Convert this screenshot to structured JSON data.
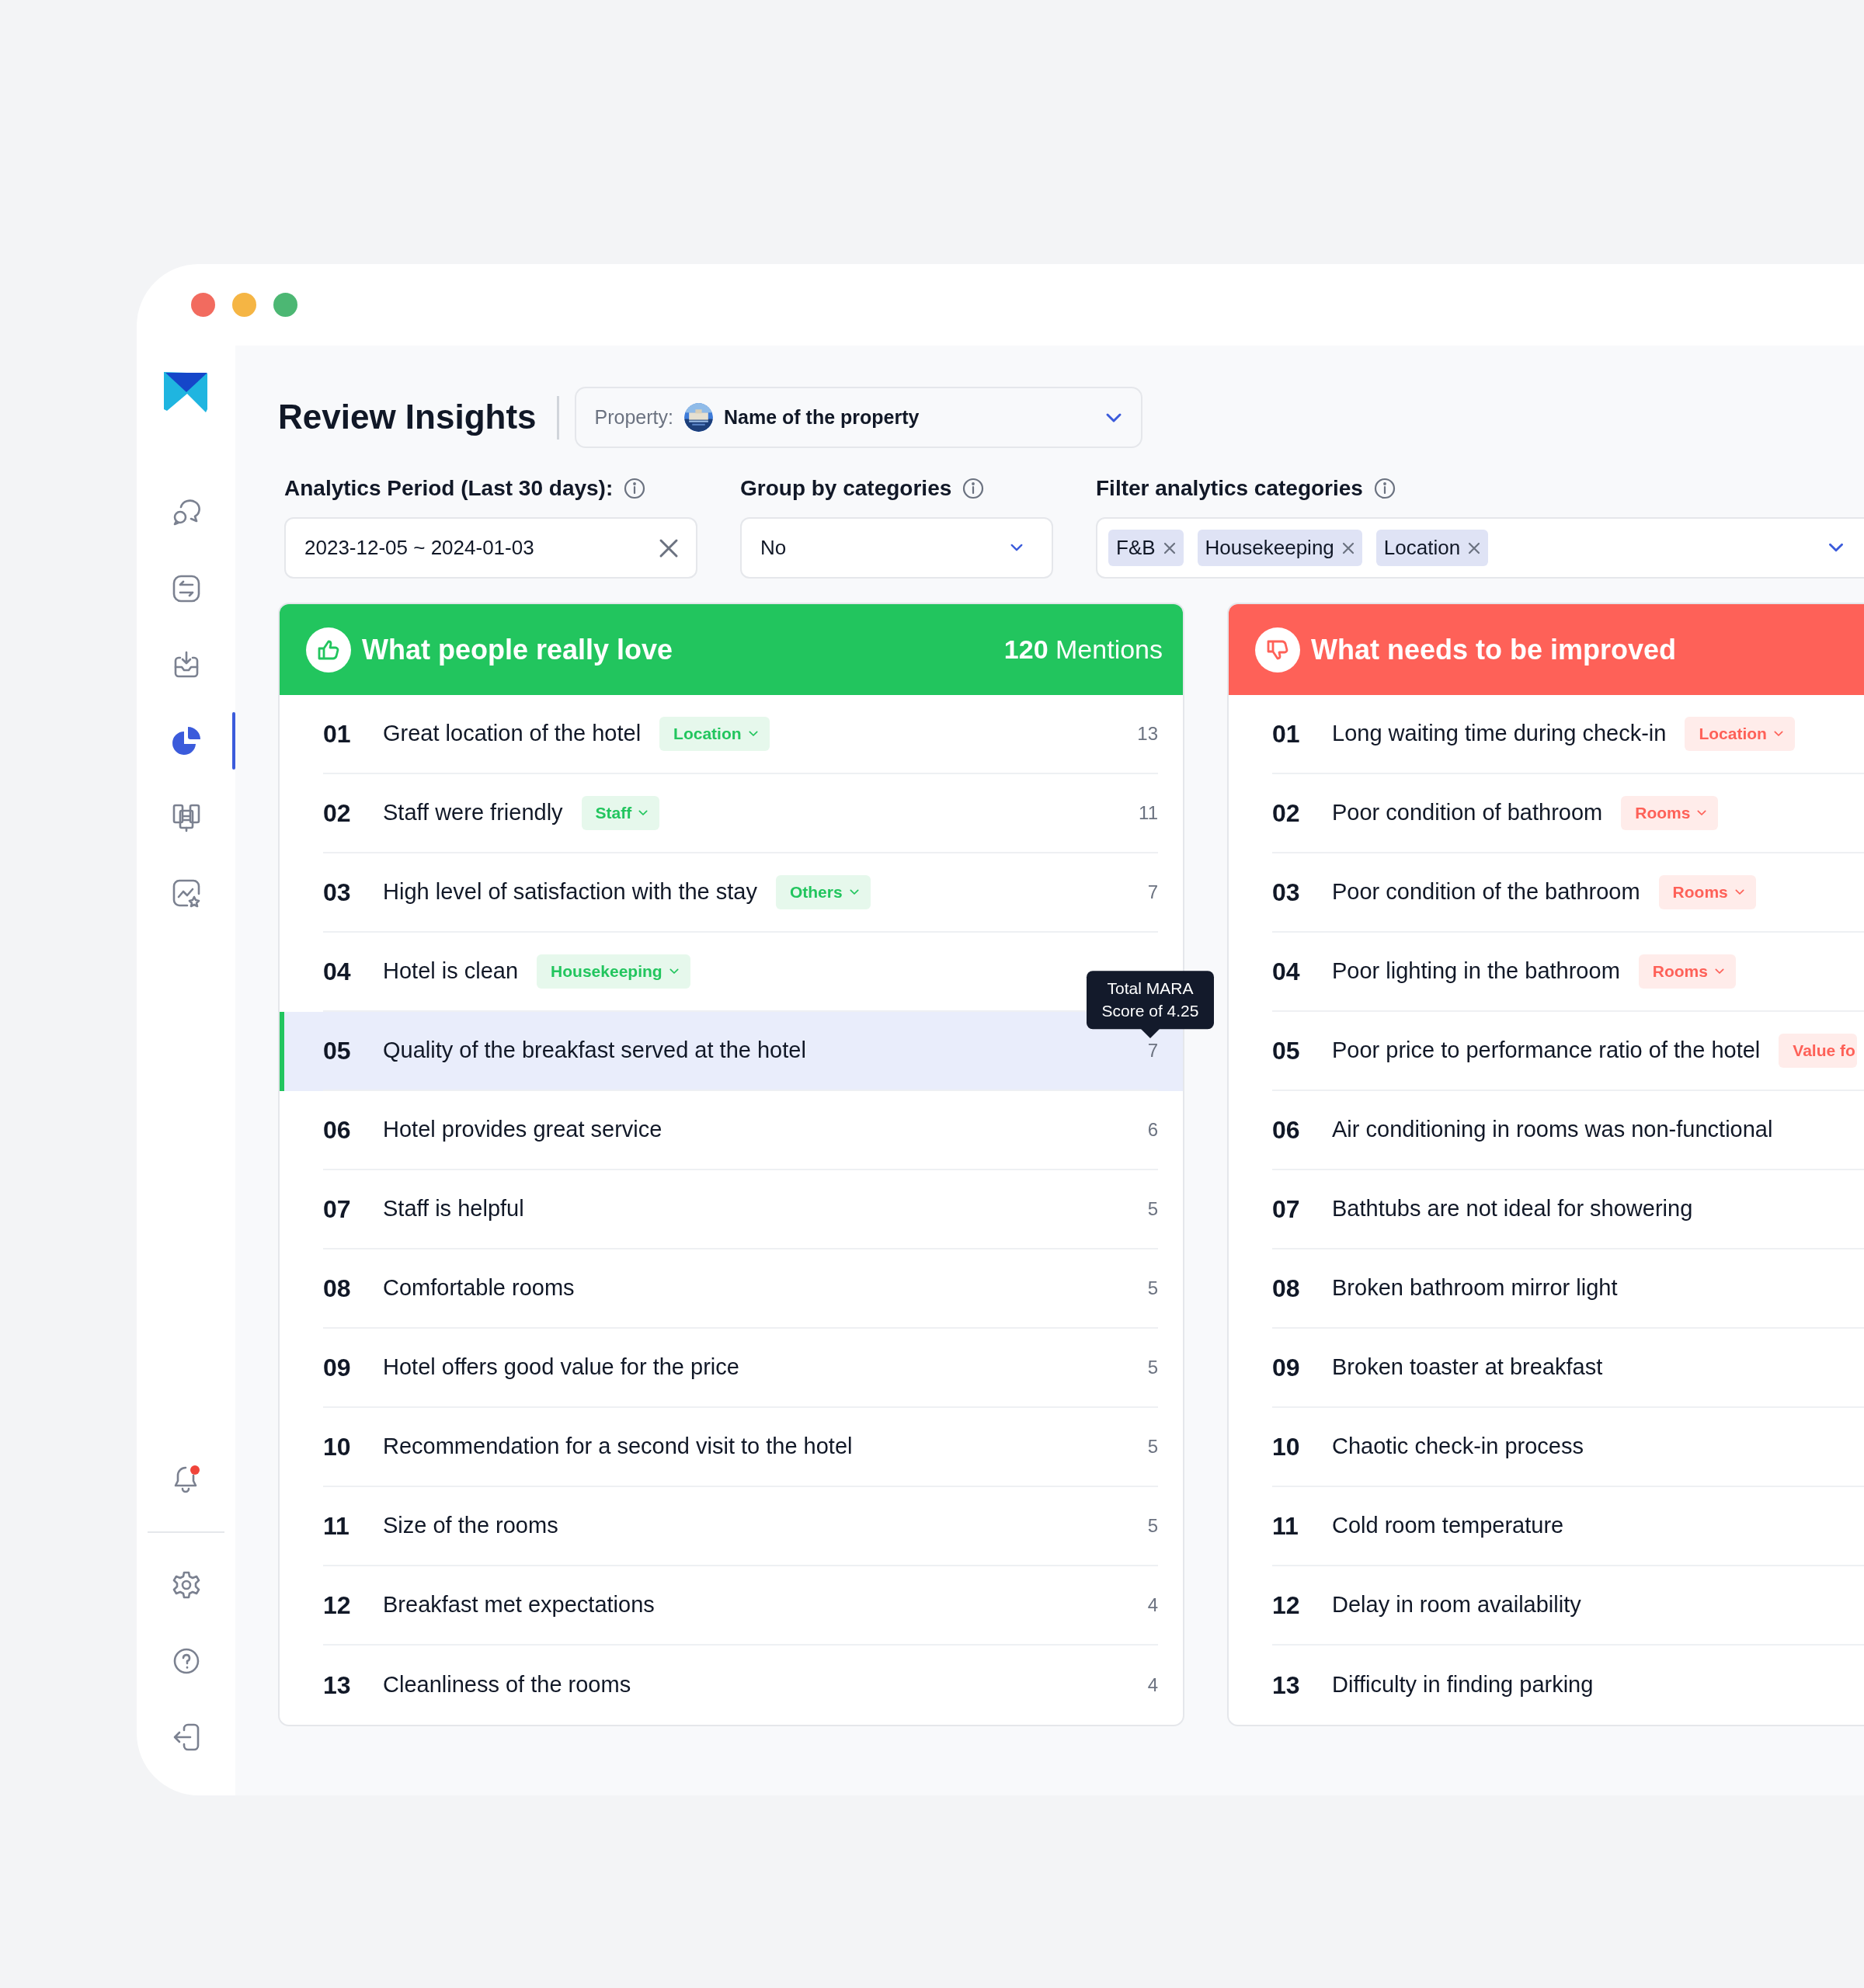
{
  "sidebar": {
    "items": [
      {
        "kind": "chat",
        "selected": false
      },
      {
        "kind": "transfer",
        "selected": false
      },
      {
        "kind": "inbox",
        "selected": false
      },
      {
        "kind": "pie",
        "selected": true
      },
      {
        "kind": "docs",
        "selected": false
      },
      {
        "kind": "chart-star",
        "selected": false
      }
    ],
    "bottom_items": [
      {
        "kind": "bell",
        "badge": true,
        "selected": false
      },
      {
        "kind": "gear",
        "selected": false
      },
      {
        "kind": "help",
        "selected": false
      },
      {
        "kind": "logout",
        "selected": false
      }
    ]
  },
  "header": {
    "title": "Review Insights",
    "property": {
      "label": "Property:",
      "value": "Name of the property"
    }
  },
  "filters": [
    {
      "kind": "date",
      "label": "Analytics Period (Last 30 days):",
      "info": true,
      "value": "2023-12-05 ~ 2024-01-03"
    },
    {
      "kind": "select",
      "label": "Group by categories",
      "info": true,
      "value": "No"
    },
    {
      "kind": "multi",
      "label": "Filter analytics categories",
      "info": true,
      "chips": [
        "F&B",
        "Housekeeping",
        "Location"
      ]
    }
  ],
  "panels": [
    {
      "kind": "positive",
      "title": "What people really love",
      "count": "120",
      "count_label": "Mentions",
      "items": [
        {
          "number": "01",
          "text": "Great location of the hotel",
          "tag": {
            "label": "Location",
            "caret": true
          },
          "count": "13",
          "selected": false
        },
        {
          "number": "02",
          "text": "Staff were friendly",
          "tag": {
            "label": "Staff",
            "caret": true
          },
          "count": "11",
          "selected": false
        },
        {
          "number": "03",
          "text": "High level of satisfaction with the stay",
          "tag": {
            "label": "Others",
            "caret": true
          },
          "count": "7",
          "selected": false
        },
        {
          "number": "04",
          "text": "Hotel is clean",
          "tag": {
            "label": "Housekeeping",
            "caret": true
          },
          "selected": false
        },
        {
          "number": "05",
          "text": "Quality of the breakfast served at the hotel",
          "count": "7",
          "selected": true,
          "tooltip": "Total MARA Score of 4.25"
        },
        {
          "number": "06",
          "text": "Hotel provides great service",
          "count": "6",
          "selected": false
        },
        {
          "number": "07",
          "text": "Staff is helpful",
          "count": "5",
          "selected": false
        },
        {
          "number": "08",
          "text": "Comfortable rooms",
          "count": "5",
          "selected": false
        },
        {
          "number": "09",
          "text": "Hotel offers good value for the price",
          "count": "5",
          "selected": false
        },
        {
          "number": "10",
          "text": "Recommendation for a second visit to the hotel",
          "count": "5",
          "selected": false
        },
        {
          "number": "11",
          "text": "Size of the rooms",
          "count": "5",
          "selected": false
        },
        {
          "number": "12",
          "text": "Breakfast met expectations",
          "count": "4",
          "selected": false
        },
        {
          "number": "13",
          "text": "Cleanliness of the rooms",
          "count": "4",
          "selected": false
        }
      ]
    },
    {
      "kind": "negative",
      "title": "What needs to be improved",
      "items": [
        {
          "number": "01",
          "text": "Long waiting time during check-in",
          "tag": {
            "label": "Location",
            "caret": true
          },
          "selected": false
        },
        {
          "number": "02",
          "text": "Poor condition of bathroom",
          "tag": {
            "label": "Rooms",
            "caret": true
          },
          "selected": false
        },
        {
          "number": "03",
          "text": "Poor condition of the bathroom",
          "tag": {
            "label": "Rooms",
            "caret": true
          },
          "selected": false
        },
        {
          "number": "04",
          "text": "Poor lighting in the bathroom",
          "tag": {
            "label": "Rooms",
            "caret": true
          },
          "selected": false
        },
        {
          "number": "05",
          "text": "Poor price to performance ratio of the hotel",
          "tag": {
            "label": "Value fo",
            "caret": false
          },
          "selected": false
        },
        {
          "number": "06",
          "text": "Air conditioning in rooms was non-functional",
          "selected": false
        },
        {
          "number": "07",
          "text": "Bathtubs are not ideal for showering",
          "selected": false
        },
        {
          "number": "08",
          "text": "Broken bathroom mirror light",
          "selected": false
        },
        {
          "number": "09",
          "text": "Broken toaster at breakfast",
          "selected": false
        },
        {
          "number": "10",
          "text": "Chaotic check-in process",
          "selected": false
        },
        {
          "number": "11",
          "text": "Cold room temperature",
          "selected": false
        },
        {
          "number": "12",
          "text": "Delay in room availability",
          "selected": false
        },
        {
          "number": "13",
          "text": "Difficulty in finding parking",
          "selected": false
        }
      ]
    }
  ]
}
